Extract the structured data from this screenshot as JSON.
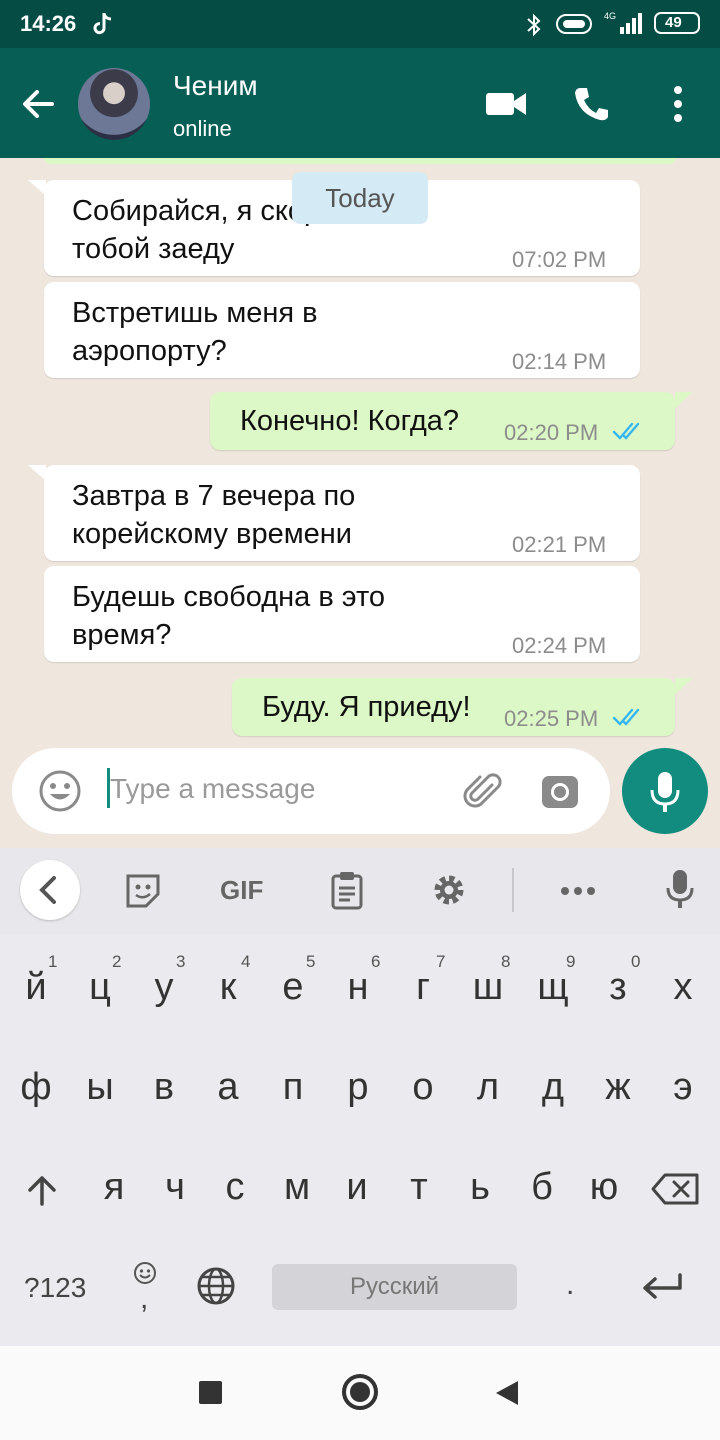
{
  "status_bar": {
    "time": "14:26",
    "battery": "49",
    "network": "4G"
  },
  "header": {
    "contact_name": "Ченим",
    "contact_status": "online"
  },
  "chat": {
    "date_chip": "Today",
    "messages": [
      {
        "dir": "in",
        "lines": [
          "Собирайся, я скоро",
          "тобой заеду"
        ],
        "time": "07:02 PM"
      },
      {
        "dir": "in",
        "lines": [
          "Встретишь меня в",
          "аэропорту?"
        ],
        "time": "02:14 PM"
      },
      {
        "dir": "out",
        "lines": [
          "Конечно! Когда?"
        ],
        "time": "02:20 PM"
      },
      {
        "dir": "in",
        "lines": [
          "Завтра в 7 вечера по",
          "корейскому времени"
        ],
        "time": "02:21 PM"
      },
      {
        "dir": "in",
        "lines": [
          "Будешь свободна в это",
          "время?"
        ],
        "time": "02:24 PM"
      },
      {
        "dir": "out",
        "lines": [
          "Буду. Я приеду!"
        ],
        "time": "02:25 PM"
      }
    ]
  },
  "input": {
    "placeholder": "Type a message"
  },
  "keyboard": {
    "toolbar": {
      "gif_label": "GIF"
    },
    "row1": [
      "й",
      "ц",
      "у",
      "к",
      "е",
      "н",
      "г",
      "ш",
      "щ",
      "з",
      "х"
    ],
    "row1_hints": [
      "1",
      "2",
      "3",
      "4",
      "5",
      "6",
      "7",
      "8",
      "9",
      "0"
    ],
    "row2": [
      "ф",
      "ы",
      "в",
      "а",
      "п",
      "р",
      "о",
      "л",
      "д",
      "ж",
      "э"
    ],
    "row3": [
      "я",
      "ч",
      "с",
      "м",
      "и",
      "т",
      "ь",
      "б",
      "ю"
    ],
    "symbols_label": "?123",
    "comma_label": ",",
    "space_label": "Русский",
    "period_label": "."
  },
  "colors": {
    "header": "#075e54",
    "statusbar": "#054d44",
    "accent": "#128c7e",
    "out_bubble": "#dcf8c6",
    "read_ticks": "#34b7f1"
  }
}
